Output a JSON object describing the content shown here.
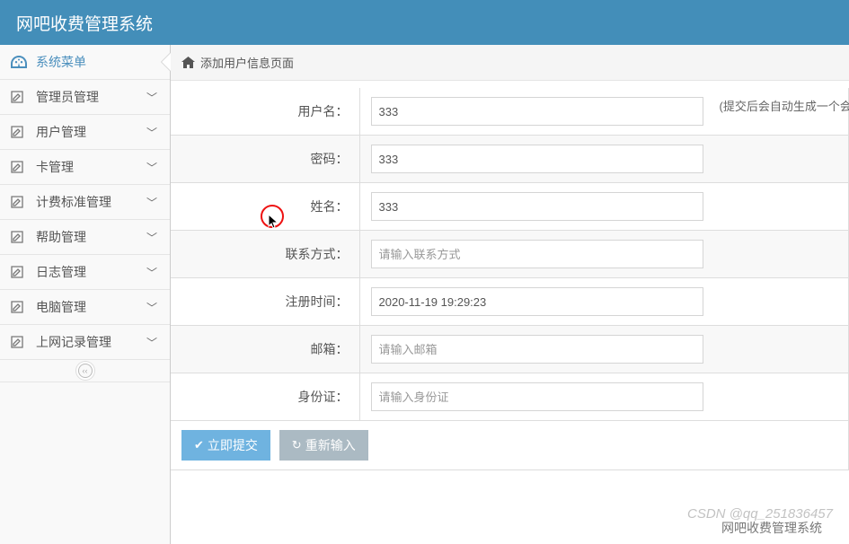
{
  "header": {
    "title": "网吧收费管理系统"
  },
  "sidebar": {
    "items": [
      {
        "label": "系统菜单",
        "icon": "dashboard",
        "active": true
      },
      {
        "label": "管理员管理",
        "icon": "edit"
      },
      {
        "label": "用户管理",
        "icon": "edit"
      },
      {
        "label": "卡管理",
        "icon": "edit"
      },
      {
        "label": "计费标准管理",
        "icon": "edit"
      },
      {
        "label": "帮助管理",
        "icon": "edit"
      },
      {
        "label": "日志管理",
        "icon": "edit"
      },
      {
        "label": "电脑管理",
        "icon": "edit"
      },
      {
        "label": "上网记录管理",
        "icon": "edit"
      }
    ]
  },
  "breadcrumb": {
    "title": "添加用户信息页面"
  },
  "form": {
    "rows": [
      {
        "label": "用户名：",
        "value": "333",
        "placeholder": "",
        "hint": "(提交后会自动生成一个会"
      },
      {
        "label": "密码：",
        "value": "333",
        "placeholder": ""
      },
      {
        "label": "姓名：",
        "value": "333",
        "placeholder": ""
      },
      {
        "label": "联系方式：",
        "value": "",
        "placeholder": "请输入联系方式"
      },
      {
        "label": "注册时间：",
        "value": "2020-11-19 19:29:23",
        "placeholder": ""
      },
      {
        "label": "邮箱：",
        "value": "",
        "placeholder": "请输入邮箱"
      },
      {
        "label": "身份证：",
        "value": "",
        "placeholder": "请输入身份证"
      }
    ],
    "buttons": {
      "submit": "立即提交",
      "reset": "重新输入"
    }
  },
  "footer": {
    "text": "网吧收费管理系统"
  },
  "watermark": {
    "text": "CSDN @qq_251836457"
  }
}
